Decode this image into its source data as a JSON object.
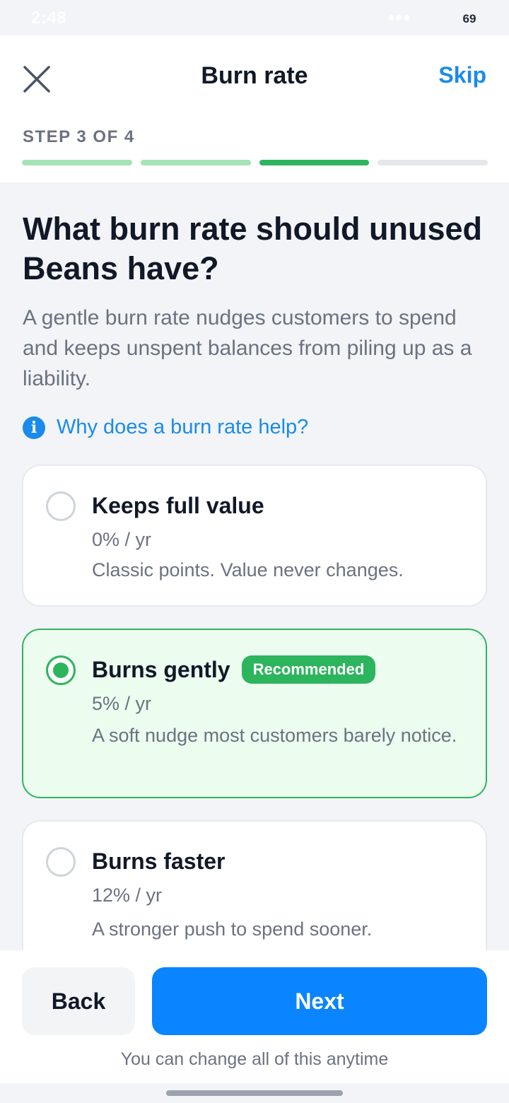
{
  "status_bar": {
    "time": "2:48",
    "signal": "●●●",
    "battery": "69"
  },
  "header": {
    "title": "Burn rate",
    "skip_label": "Skip",
    "step_label": "STEP 3 OF 4",
    "progress": {
      "current_step": 3,
      "total_steps": 4
    }
  },
  "main": {
    "question": "What burn rate should unused Beans have?",
    "description": "A gentle burn rate nudges customers to spend and keeps unspent balances from piling up as a liability.",
    "info_icon": "i",
    "info_link": "Why does a burn rate help?",
    "options": [
      {
        "title": "Keeps full value",
        "rate": "0% / yr",
        "description": "Classic points. Value never changes.",
        "selected": false
      },
      {
        "title": "Burns gently",
        "badge": "Recommended",
        "rate": "5% / yr",
        "description": "A soft nudge most customers barely notice.",
        "selected": true
      },
      {
        "title": "Burns faster",
        "rate": "12% / yr",
        "description": "A stronger push to spend sooner.",
        "selected": false
      }
    ]
  },
  "footer": {
    "back_label": "Back",
    "next_label": "Next",
    "note": "You can change all of this anytime"
  },
  "colors": {
    "accent_blue": "#0a84ff",
    "link_blue": "#1a8bea",
    "success_green": "#2db55d",
    "selected_bg": "#ecfcef"
  },
  "icons": [
    "close-icon",
    "info-icon",
    "radio-icon"
  ]
}
